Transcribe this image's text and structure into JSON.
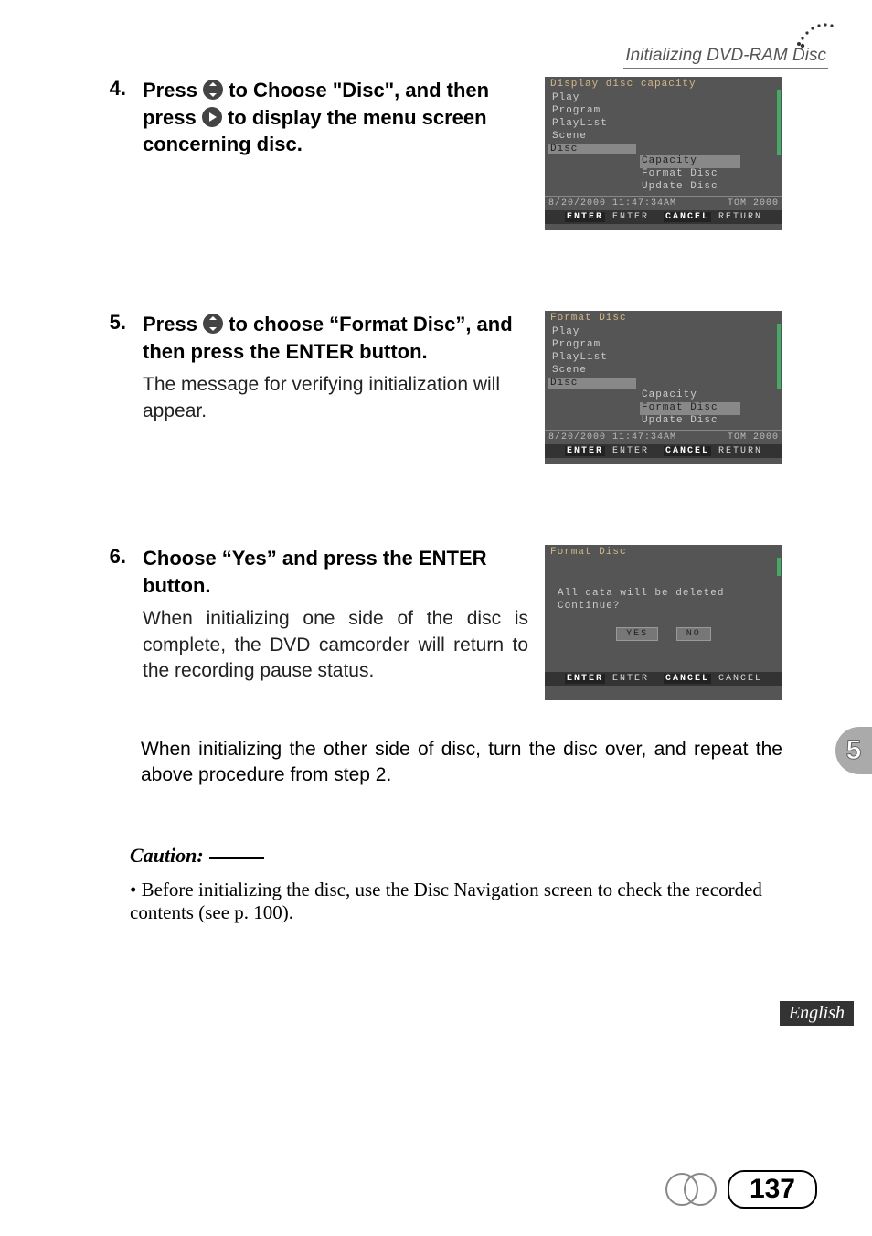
{
  "header": {
    "title": "Initializing DVD-RAM Disc"
  },
  "steps": {
    "s4": {
      "num": "4.",
      "line1a": "Press ",
      "line1b": " to Choose \"Disc\", and then press ",
      "line1c": " to display the menu screen concerning disc."
    },
    "s5": {
      "num": "5.",
      "line1a": "Press ",
      "line1b": " to choose “Format Disc”, and then press the ENTER button.",
      "body": "The message for verifying initialization will appear."
    },
    "s6": {
      "num": "6.",
      "line1": "Choose “Yes” and press the ENTER button.",
      "body": "When initializing one side of the disc is complete, the DVD camcorder will return to the recording pause status."
    }
  },
  "after": "When initializing the other side of disc, turn the disc over, and repeat the above procedure from step 2.",
  "caution": {
    "label": "Caution:",
    "item": "• Before initializing the disc, use the Disc Navigation screen to check the recorded contents (see p. 100)."
  },
  "screens": {
    "s4": {
      "title": "Display disc capacity",
      "menu": [
        "Play",
        "Program",
        "PlayList",
        "Scene",
        "Disc"
      ],
      "sel_menu": "Disc",
      "sub": [
        "Capacity",
        "Format Disc",
        "Update Disc"
      ],
      "sel_sub": "Capacity",
      "foot_left": "8/20/2000 11:47:34AM",
      "foot_right": "TOM 2000",
      "bar_enter_k": "ENTER",
      "bar_enter_v": "ENTER",
      "bar_cancel_k": "CANCEL",
      "bar_cancel_v": "RETURN"
    },
    "s5": {
      "title": "Format Disc",
      "menu": [
        "Play",
        "Program",
        "PlayList",
        "Scene",
        "Disc"
      ],
      "sel_menu": "Disc",
      "sub": [
        "Capacity",
        "Format Disc",
        "Update Disc"
      ],
      "sel_sub": "Format Disc",
      "foot_left": "8/20/2000 11:47:34AM",
      "foot_right": "TOM 2000",
      "bar_enter_k": "ENTER",
      "bar_enter_v": "ENTER",
      "bar_cancel_k": "CANCEL",
      "bar_cancel_v": "RETURN"
    },
    "s6": {
      "title": "Format Disc",
      "msg1": "All data will be deleted",
      "msg2": "Continue?",
      "yes": "YES",
      "no": "NO",
      "bar_enter_k": "ENTER",
      "bar_enter_v": "ENTER",
      "bar_cancel_k": "CANCEL",
      "bar_cancel_v": "CANCEL"
    }
  },
  "side_tab": "5",
  "lang": "English",
  "page_number": "137"
}
